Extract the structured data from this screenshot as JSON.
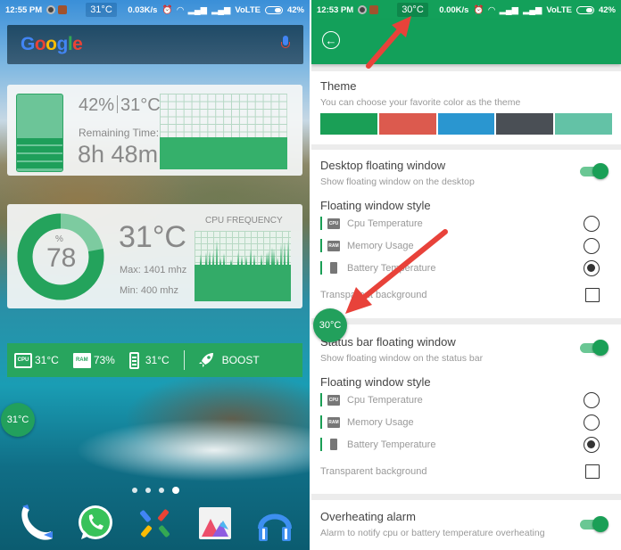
{
  "left_screen": {
    "status_bar": {
      "time": "12:55 PM",
      "temperature": "31°C",
      "net_speed": "0.03K/s",
      "network": "VoLTE",
      "battery": "42%"
    },
    "google_search": {
      "logo_letters": [
        "G",
        "o",
        "o",
        "g",
        "l",
        "e"
      ],
      "mic_icon": "mic-icon"
    },
    "battery_widget": {
      "percent": "42%",
      "temperature": "31°C",
      "remaining_label": "Remaining Time:",
      "remaining_time": "8h 48m",
      "level_fraction": 0.42
    },
    "cpu_widget": {
      "percent_symbol": "%",
      "usage": "78",
      "usage_fraction": 0.78,
      "temperature": "31°C",
      "max": "Max:  1401 mhz",
      "min": "Min:   400 mhz",
      "freq_label": "CPU FREQUENCY"
    },
    "status_widget": {
      "cpu_chip": "CPU",
      "cpu_temp": "31°C",
      "ram_chip": "RAM",
      "ram_usage": "73%",
      "battery_temp": "31°C",
      "boost_label": "BOOST"
    },
    "floating_bubble": "31°C",
    "page_dots": 4,
    "active_page": 4,
    "dock": [
      "phone-app",
      "whatsapp-app",
      "pinwheel-app",
      "gallery-app",
      "music-app"
    ]
  },
  "right_screen": {
    "status_bar": {
      "time": "12:53 PM",
      "temperature": "30°C",
      "net_speed": "0.00K/s",
      "network": "VoLTE",
      "battery": "42%"
    },
    "theme": {
      "title": "Theme",
      "subtitle": "You can choose your favorite color as the theme",
      "colors": [
        "#1a9f56",
        "#dc5a4e",
        "#2a96d0",
        "#4a4f55",
        "#63c2a6"
      ]
    },
    "desktop_floating": {
      "title": "Desktop floating window",
      "subtitle": "Show floating window on the desktop",
      "enabled": true,
      "style_title": "Floating window style",
      "options": [
        {
          "label": "Cpu Temperature",
          "chip": "CPU",
          "selected": false
        },
        {
          "label": "Memory Usage",
          "chip": "RAM",
          "selected": false
        },
        {
          "label": "Battery Temperature",
          "chip": "",
          "selected": true
        }
      ],
      "transparent_label": "Transparent background",
      "transparent_checked": false
    },
    "statusbar_floating": {
      "title": "Status bar floating window",
      "subtitle": "Show floating window on the status bar",
      "enabled": true,
      "style_title": "Floating window style",
      "options": [
        {
          "label": "Cpu Temperature",
          "chip": "CPU",
          "selected": false
        },
        {
          "label": "Memory Usage",
          "chip": "RAM",
          "selected": false
        },
        {
          "label": "Battery Temperature",
          "chip": "",
          "selected": true
        }
      ],
      "transparent_label": "Transparent background",
      "transparent_checked": false
    },
    "overheating": {
      "title": "Overheating alarm",
      "subtitle": "Alarm to notify cpu or battery temperature overheating",
      "enabled": true
    },
    "floating_bubble": "30°C"
  }
}
